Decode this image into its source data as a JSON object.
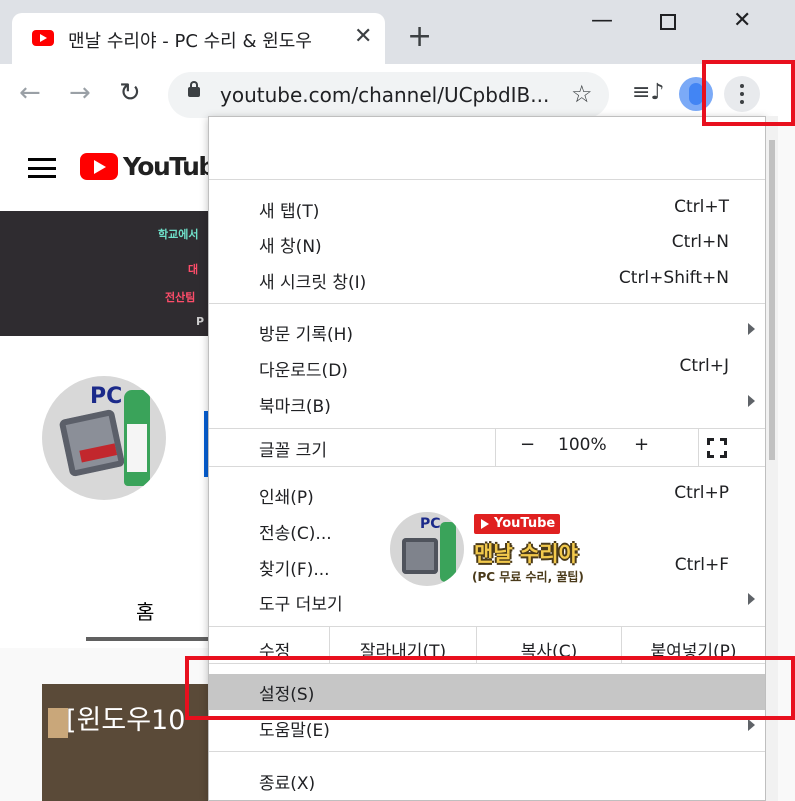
{
  "browser": {
    "tab": {
      "title": "맨날 수리야 - PC 수리 & 윈도우",
      "close": "✕"
    },
    "new_tab": "+",
    "window": {
      "minimize": "—",
      "close": "✕"
    },
    "toolbar": {
      "back": "←",
      "forward": "→",
      "reload": "↻",
      "url": "youtube.com/channel/UCpbdIB...",
      "star": "☆",
      "media": "≡♪"
    },
    "icons": [
      "arrow-left-icon",
      "arrow-right-icon",
      "reload-icon",
      "lock-icon",
      "star-icon",
      "media-control-icon",
      "profile-icon",
      "more-vert-icon",
      "fullscreen-icon",
      "chevron-right-icon"
    ]
  },
  "youtube": {
    "logo": "YouTube",
    "banner_lines": [
      "학교에서 ",
      "대",
      "전산팀",
      "P"
    ],
    "avatar_text": "PC",
    "home_tab": "홈",
    "video_title": "[윈도우10 "
  },
  "menu": {
    "group1": [
      {
        "label": "새 탭(T)",
        "shortcut": "Ctrl+T"
      },
      {
        "label": "새 창(N)",
        "shortcut": "Ctrl+N"
      },
      {
        "label": "새 시크릿 창(I)",
        "shortcut": "Ctrl+Shift+N"
      }
    ],
    "group2": [
      {
        "label": "방문 기록(H)",
        "shortcut": ""
      },
      {
        "label": "다운로드(D)",
        "shortcut": "Ctrl+J"
      },
      {
        "label": "북마크(B)",
        "shortcut": ""
      }
    ],
    "zoom": {
      "label": "글꼴 크기",
      "minus": "−",
      "value": "100%",
      "plus": "+"
    },
    "group3": [
      {
        "label": "인쇄(P)",
        "shortcut": "Ctrl+P"
      },
      {
        "label": "전송(C)...",
        "shortcut": ""
      },
      {
        "label": "찾기(F)...",
        "shortcut": "Ctrl+F"
      },
      {
        "label": "도구 더보기",
        "shortcut": ""
      }
    ],
    "edit": {
      "label": "수정",
      "cut": "잘라내기(T)",
      "copy": "복사(C)",
      "paste": "붙여넣기(P)"
    },
    "settings": "설정(S)",
    "help": "도움말(E)",
    "exit": "종료(X)"
  },
  "watermark": {
    "badge": "YouTube",
    "name": "맨날 수리야",
    "sub": "(PC 무료 수리, 꿀팁)",
    "avatar_text": "PC"
  },
  "colors": {
    "highlight": "#e8101e",
    "youtube_red": "#ff0000",
    "selected_row": "#c6c6c6"
  }
}
